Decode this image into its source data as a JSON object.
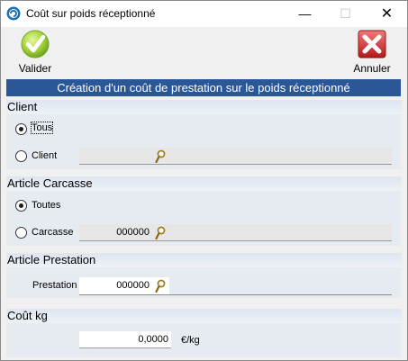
{
  "window": {
    "title": "Coût sur poids réceptionné",
    "minimize": "—",
    "maximize": "☐",
    "close": "✕"
  },
  "toolbar": {
    "valider_label": "Valider",
    "annuler_label": "Annuler"
  },
  "banner": {
    "text": "Création d'un coût de prestation sur le poids réceptionné"
  },
  "client": {
    "heading": "Client",
    "option_all": "Tous",
    "option_one": "Client",
    "selected": "Tous",
    "field_value": ""
  },
  "carcasse": {
    "heading": "Article Carcasse",
    "option_all": "Toutes",
    "option_one": "Carcasse",
    "selected": "Toutes",
    "field_value": "000000"
  },
  "prestation": {
    "heading": "Article Prestation",
    "label": "Prestation",
    "field_value": "000000"
  },
  "cout": {
    "heading": "Coût kg",
    "value": "0,0000",
    "unit": "€/kg"
  },
  "colors": {
    "banner": "#2b5797",
    "section": "#e6ebf2"
  }
}
